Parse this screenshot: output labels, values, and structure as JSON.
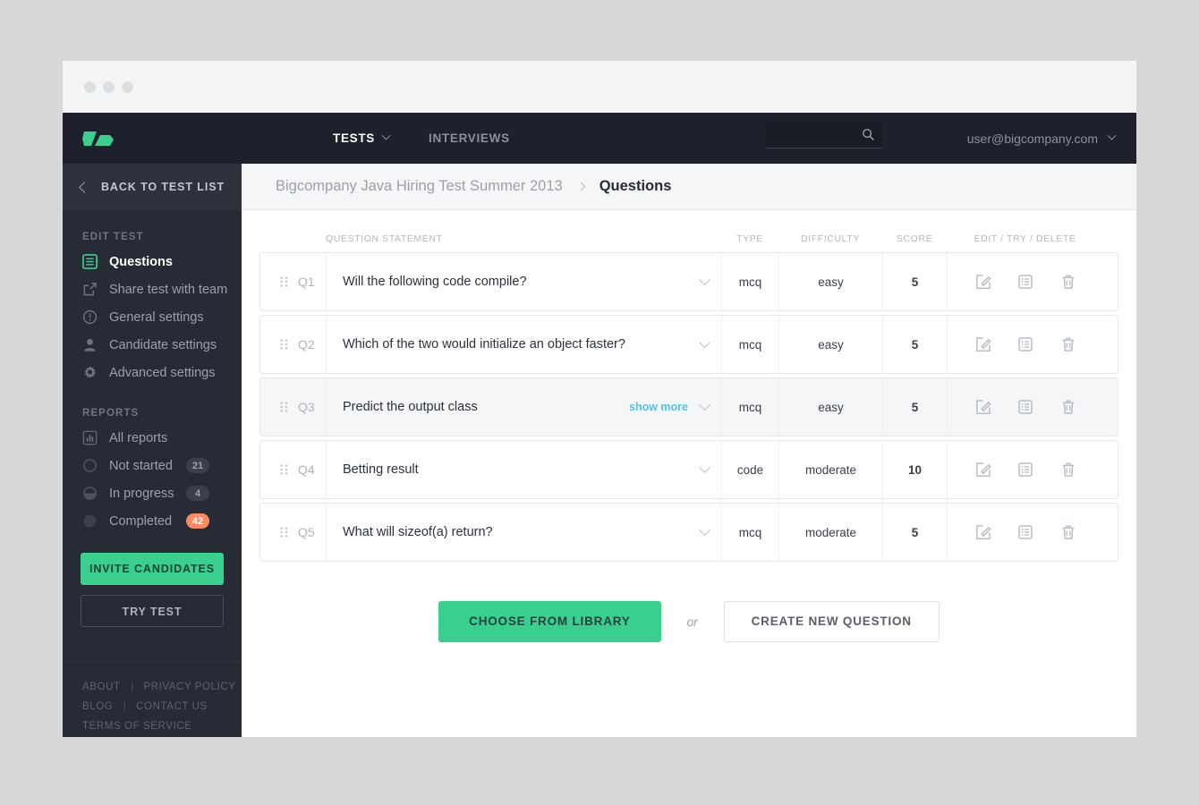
{
  "window": {
    "dots": 3
  },
  "topnav": {
    "logo_name": "brand-logo",
    "links": [
      {
        "label": "TESTS",
        "active": true,
        "has_caret": true
      },
      {
        "label": "INTERVIEWS",
        "active": false,
        "has_caret": false
      }
    ],
    "search": {
      "value": "",
      "placeholder": "",
      "icon": "search-icon"
    },
    "user": {
      "email": "user@bigcompany.com",
      "icon": "chevron-down-icon"
    }
  },
  "sidebar": {
    "back": {
      "label": "BACK TO TEST LIST",
      "icon": "chevron-left-icon"
    },
    "edit_test": {
      "title": "EDIT TEST",
      "items": [
        {
          "label": "Questions",
          "icon": "list-icon",
          "active": true
        },
        {
          "label": "Share test with team",
          "icon": "share-icon",
          "active": false
        },
        {
          "label": "General settings",
          "icon": "info-icon",
          "active": false
        },
        {
          "label": "Candidate settings",
          "icon": "user-icon",
          "active": false
        },
        {
          "label": "Advanced settings",
          "icon": "gear-icon",
          "active": false
        }
      ]
    },
    "reports": {
      "title": "REPORTS",
      "items": [
        {
          "label": "All reports",
          "icon": "bar-chart-icon",
          "badge": "",
          "badge_hot": false
        },
        {
          "label": "Not started",
          "icon": "circle-empty-icon",
          "badge": "21",
          "badge_hot": false
        },
        {
          "label": "In progress",
          "icon": "circle-half-icon",
          "badge": "4",
          "badge_hot": false
        },
        {
          "label": "Completed",
          "icon": "circle-full-icon",
          "badge": "42",
          "badge_hot": true
        }
      ]
    },
    "invite_label": "INVITE CANDIDATES",
    "try_label": "TRY TEST",
    "footer": {
      "row1": [
        "ABOUT",
        "PRIVACY POLICY"
      ],
      "row2": [
        "BLOG",
        "CONTACT US"
      ],
      "row3": [
        "TERMS OF SERVICE"
      ],
      "separator": "|"
    }
  },
  "breadcrumb": {
    "parent": "Bigcompany Java Hiring Test Summer 2013",
    "separator_icon": "chevron-right-icon",
    "current": "Questions"
  },
  "table": {
    "headers": {
      "drag": "",
      "statement": "QUESTION STATEMENT",
      "type": "TYPE",
      "difficulty": "DIFFICULTY",
      "score": "SCORE",
      "actions": "EDIT / TRY / DELETE"
    },
    "row_action_icons": [
      "edit-icon",
      "try-icon",
      "delete-icon"
    ],
    "rows": [
      {
        "id": "Q1",
        "statement": "Will the following code compile?",
        "type": "mcq",
        "difficulty": "easy",
        "score": "5",
        "show_more": "",
        "highlighted": false
      },
      {
        "id": "Q2",
        "statement": "Which of the two would initialize an object faster?",
        "type": "mcq",
        "difficulty": "easy",
        "score": "5",
        "show_more": "",
        "highlighted": false
      },
      {
        "id": "Q3",
        "statement": "Predict the output class",
        "type": "mcq",
        "difficulty": "easy",
        "score": "5",
        "show_more": "show more",
        "highlighted": true
      },
      {
        "id": "Q4",
        "statement": "Betting result",
        "type": "code",
        "difficulty": "moderate",
        "score": "10",
        "show_more": "",
        "highlighted": false
      },
      {
        "id": "Q5",
        "statement": "What will sizeof(a) return?",
        "type": "mcq",
        "difficulty": "moderate",
        "score": "5",
        "show_more": "",
        "highlighted": false
      }
    ]
  },
  "actions": {
    "library_label": "CHOOSE FROM LIBRARY",
    "or_label": "or",
    "new_question_label": "CREATE NEW QUESTION"
  },
  "colors": {
    "accent_green": "#3ace8f",
    "badge_hot": "#f98a62",
    "nav_dark": "#1e212b",
    "sidebar_dark": "#272b36",
    "link_blue": "#4fc3e8"
  }
}
